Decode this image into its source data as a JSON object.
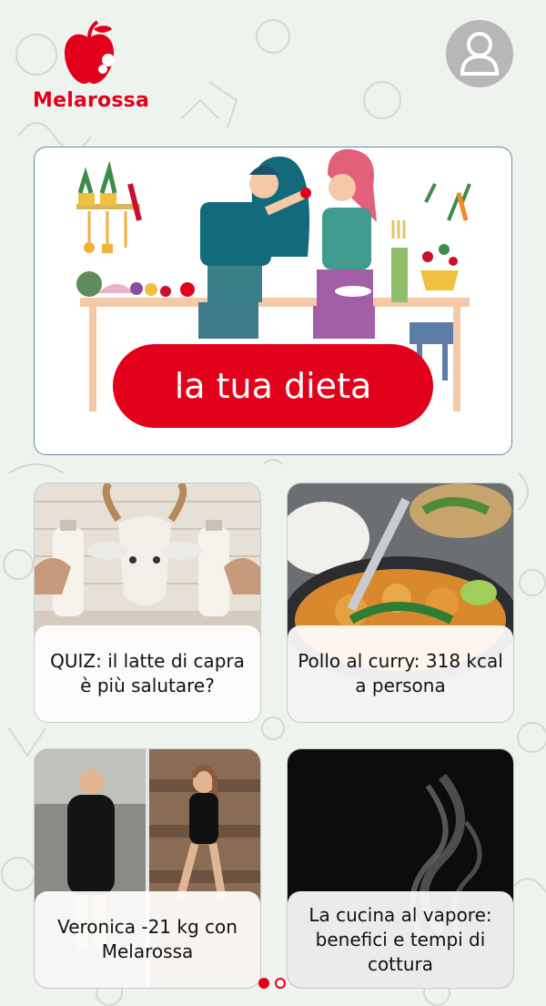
{
  "brand": {
    "name": "Melarossa",
    "color": "#e2001a"
  },
  "header": {
    "profile_icon": "user-icon"
  },
  "hero": {
    "button_label": "la tua dieta"
  },
  "cards": [
    {
      "title": "QUIZ: il latte di capra è più salutare?",
      "image": "goat-milk-photo"
    },
    {
      "title": "Pollo al curry: 318 kcal a persona",
      "image": "chicken-curry-photo"
    },
    {
      "title": "Veronica -21 kg con Melarossa",
      "image": "before-after-photo"
    },
    {
      "title": "La cucina al vapore: benefici e tempi di cottura",
      "image": "steam-photo"
    }
  ],
  "pagination": {
    "pages": 2,
    "current": 1
  }
}
